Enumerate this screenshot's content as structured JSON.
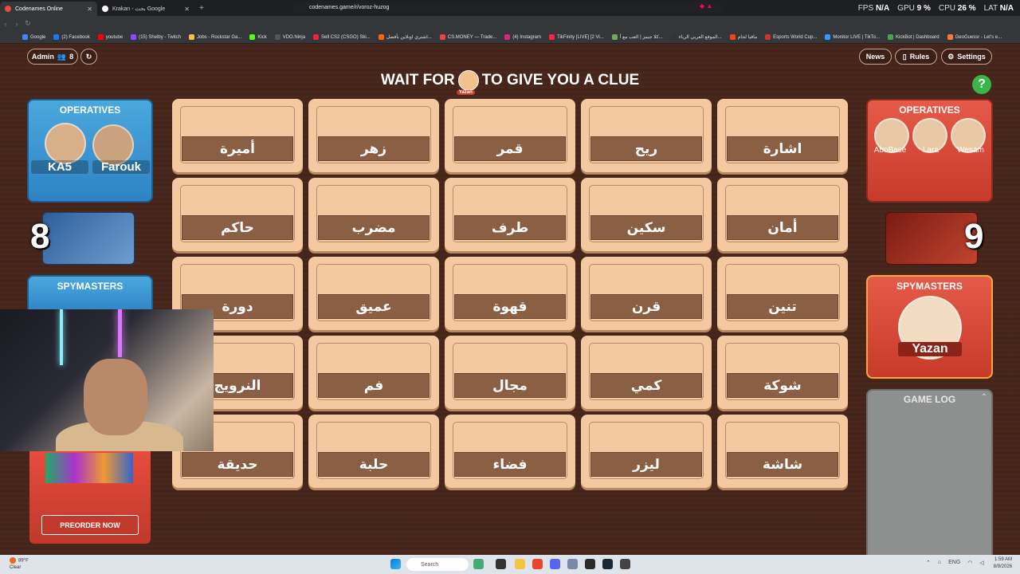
{
  "browser": {
    "tabs": [
      {
        "label": "Codenames Online",
        "active": true
      },
      {
        "label": "Krakan - بحث Google",
        "active": false
      }
    ],
    "url": "codenames.game/r/voroz-huzog",
    "bookmarks": [
      "Google",
      "(2) Facebook",
      "youtube",
      "(15) Shelby - Twitch",
      "Jobs - Rockstar Ga...",
      "Kick",
      "VDO.Ninja",
      "Sell CS2 (CSGO) Ski...",
      "اشتري اونلاين بأفضل...",
      "CS.MONEY — Trade...",
      "(4) Instagram",
      "TikFinity [LIVE] [2 Vi...",
      "كلا جيمز | العب مع أ...",
      "الموقع العربي الرياء...",
      "مافيا لجام",
      "Esports World Cup...",
      "Monitor LIVE | TikTo...",
      "KickBot | Dashboard",
      "GeoGuessr - Let's e..."
    ],
    "perf": {
      "fps_label": "FPS",
      "fps": "N/A",
      "gpu_label": "GPU",
      "gpu": "9 %",
      "cpu_label": "CPU",
      "cpu": "26 %",
      "lat_label": "LAT",
      "lat": "N/A"
    }
  },
  "header": {
    "admin_label": "Admin",
    "player_count": "8",
    "news_label": "News",
    "rules_label": "Rules",
    "settings_label": "Settings",
    "headline_before": "WAIT FOR",
    "headline_after": "TO GIVE YOU A CLUE",
    "headline_player": "Yazan",
    "help_label": "?"
  },
  "blue_team": {
    "operatives_title": "OPERATIVES",
    "operatives": [
      "KA5",
      "Farouk"
    ],
    "remaining": "8",
    "spymasters_title": "SPYMASTERS"
  },
  "red_team": {
    "operatives_title": "OPERATIVES",
    "operatives": [
      "AboBase",
      "Lara",
      "Wesam"
    ],
    "remaining": "9",
    "spymasters_title": "SPYMASTERS",
    "spymaster": "Yazan"
  },
  "board": {
    "words": [
      [
        "أميرة",
        "زهر",
        "قمر",
        "ريح",
        "اشارة"
      ],
      [
        "حاكم",
        "مضرب",
        "طرف",
        "سكين",
        "أمان"
      ],
      [
        "دورة",
        "عميق",
        "قهوة",
        "قرن",
        "تنين"
      ],
      [
        "النرويج",
        "فم",
        "مجال",
        "كمي",
        "شوكة"
      ],
      [
        "حديقة",
        "حلبة",
        "فضاء",
        "ليزر",
        "شاشة"
      ]
    ]
  },
  "game_log": {
    "title": "GAME LOG"
  },
  "promo": {
    "button_label": "PREORDER NOW"
  },
  "taskbar": {
    "weather_temp": "89°F",
    "weather_desc": "Clear",
    "search_placeholder": "Search",
    "lang": "ENG",
    "time": "1:59 AM",
    "date": "8/9/2026"
  }
}
